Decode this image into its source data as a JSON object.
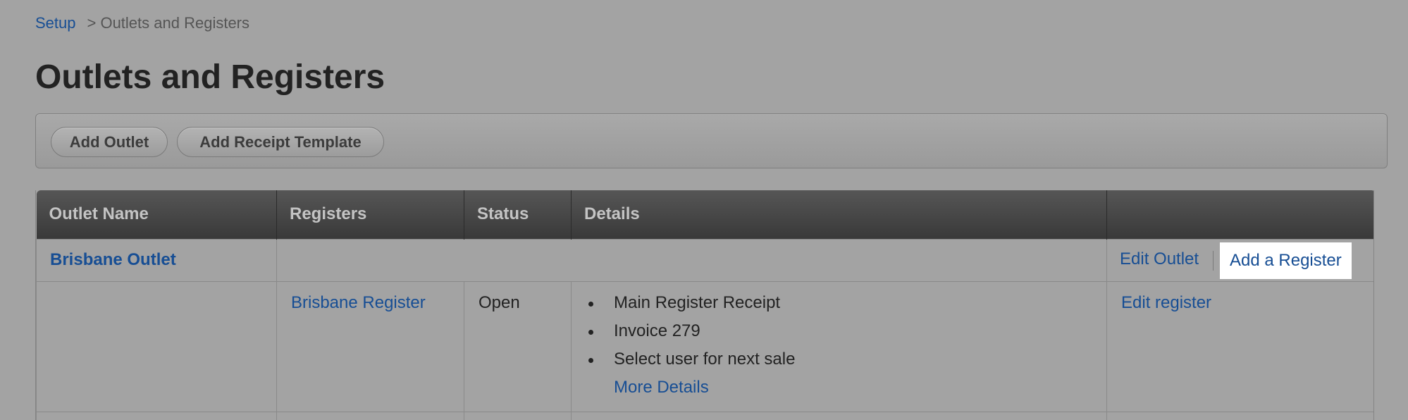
{
  "breadcrumb": {
    "root": "Setup",
    "current": "> Outlets and Registers"
  },
  "page_title": "Outlets and Registers",
  "toolbar": {
    "add_outlet": "Add Outlet",
    "add_receipt_template": "Add Receipt Template"
  },
  "table": {
    "headers": [
      "Outlet Name",
      "Registers",
      "Status",
      "Details",
      ""
    ],
    "outlet": {
      "name": "Brisbane Outlet",
      "edit_outlet": "Edit Outlet",
      "add_register": "Add a Register"
    },
    "register": {
      "name": "Brisbane Register",
      "status": "Open",
      "details": [
        "Main Register Receipt",
        "Invoice 279",
        "Select user for next sale"
      ],
      "more_details": "More Details",
      "edit_register": "Edit register"
    }
  }
}
